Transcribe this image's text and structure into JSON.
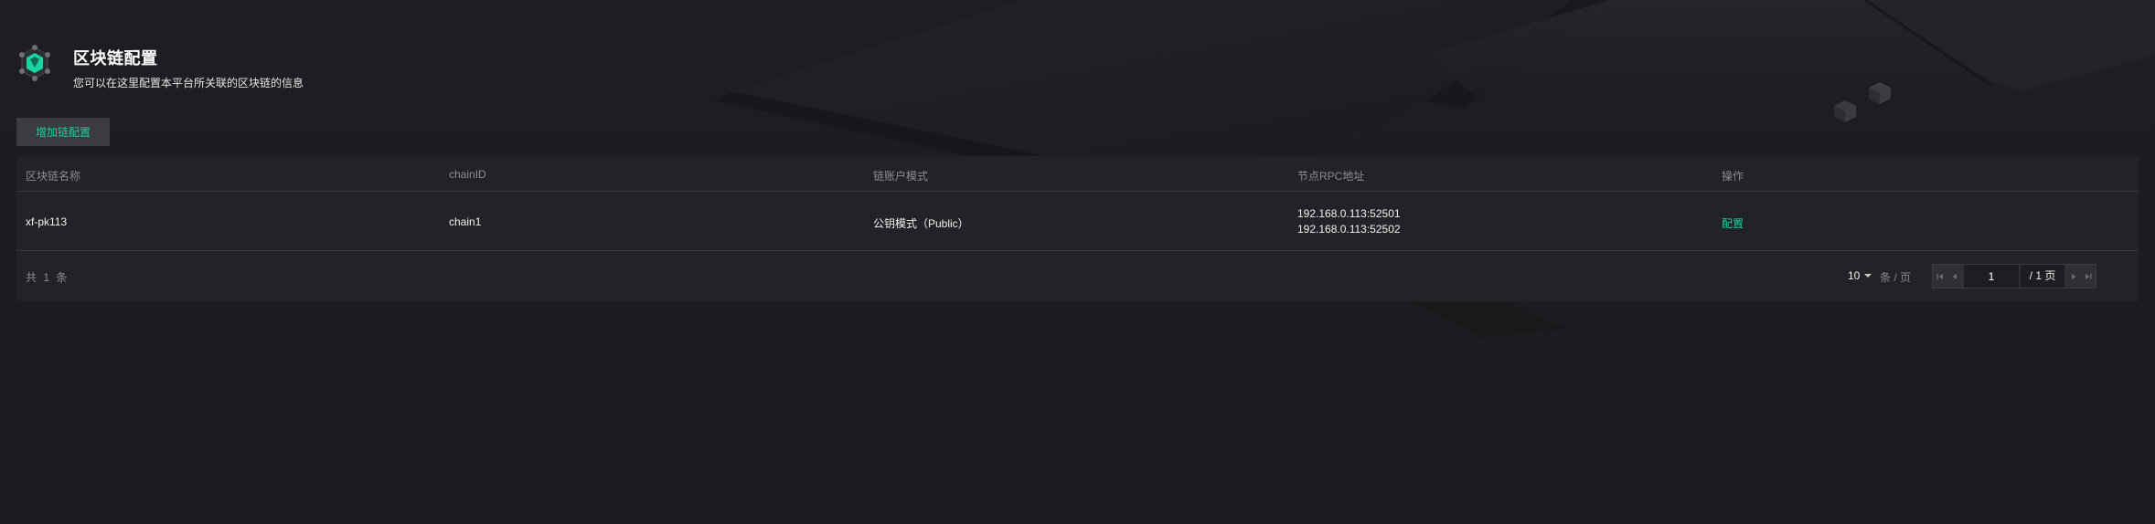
{
  "header": {
    "title": "区块链配置",
    "subtitle": "您可以在这里配置本平台所关联的区块链的信息"
  },
  "toolbar": {
    "add_label": "增加链配置"
  },
  "table": {
    "columns": [
      "区块链名称",
      "chainID",
      "链账户模式",
      "节点RPC地址",
      "操作"
    ],
    "rows": [
      {
        "name": "xf-pk113",
        "chain_id": "chain1",
        "mode": "公钥模式（Public）",
        "rpc": [
          "192.168.0.113:52501",
          "192.168.0.113:52502"
        ],
        "action": "配置"
      }
    ]
  },
  "pagination": {
    "total_text": "共 1 条",
    "page_size": "10",
    "per_page_text": "条 / 页",
    "current_page": "1",
    "total_pages_text": "/ 1 页"
  },
  "colors": {
    "accent": "#19d3a2",
    "background": "#1b1c20",
    "table_bg": "#222327",
    "header_text": "#8c8d91"
  },
  "icons": {
    "logo": "blockchain-logo-icon",
    "first": "first-page-icon",
    "prev": "prev-page-icon",
    "next": "next-page-icon",
    "last": "last-page-icon",
    "dropdown": "chevron-down-icon"
  }
}
